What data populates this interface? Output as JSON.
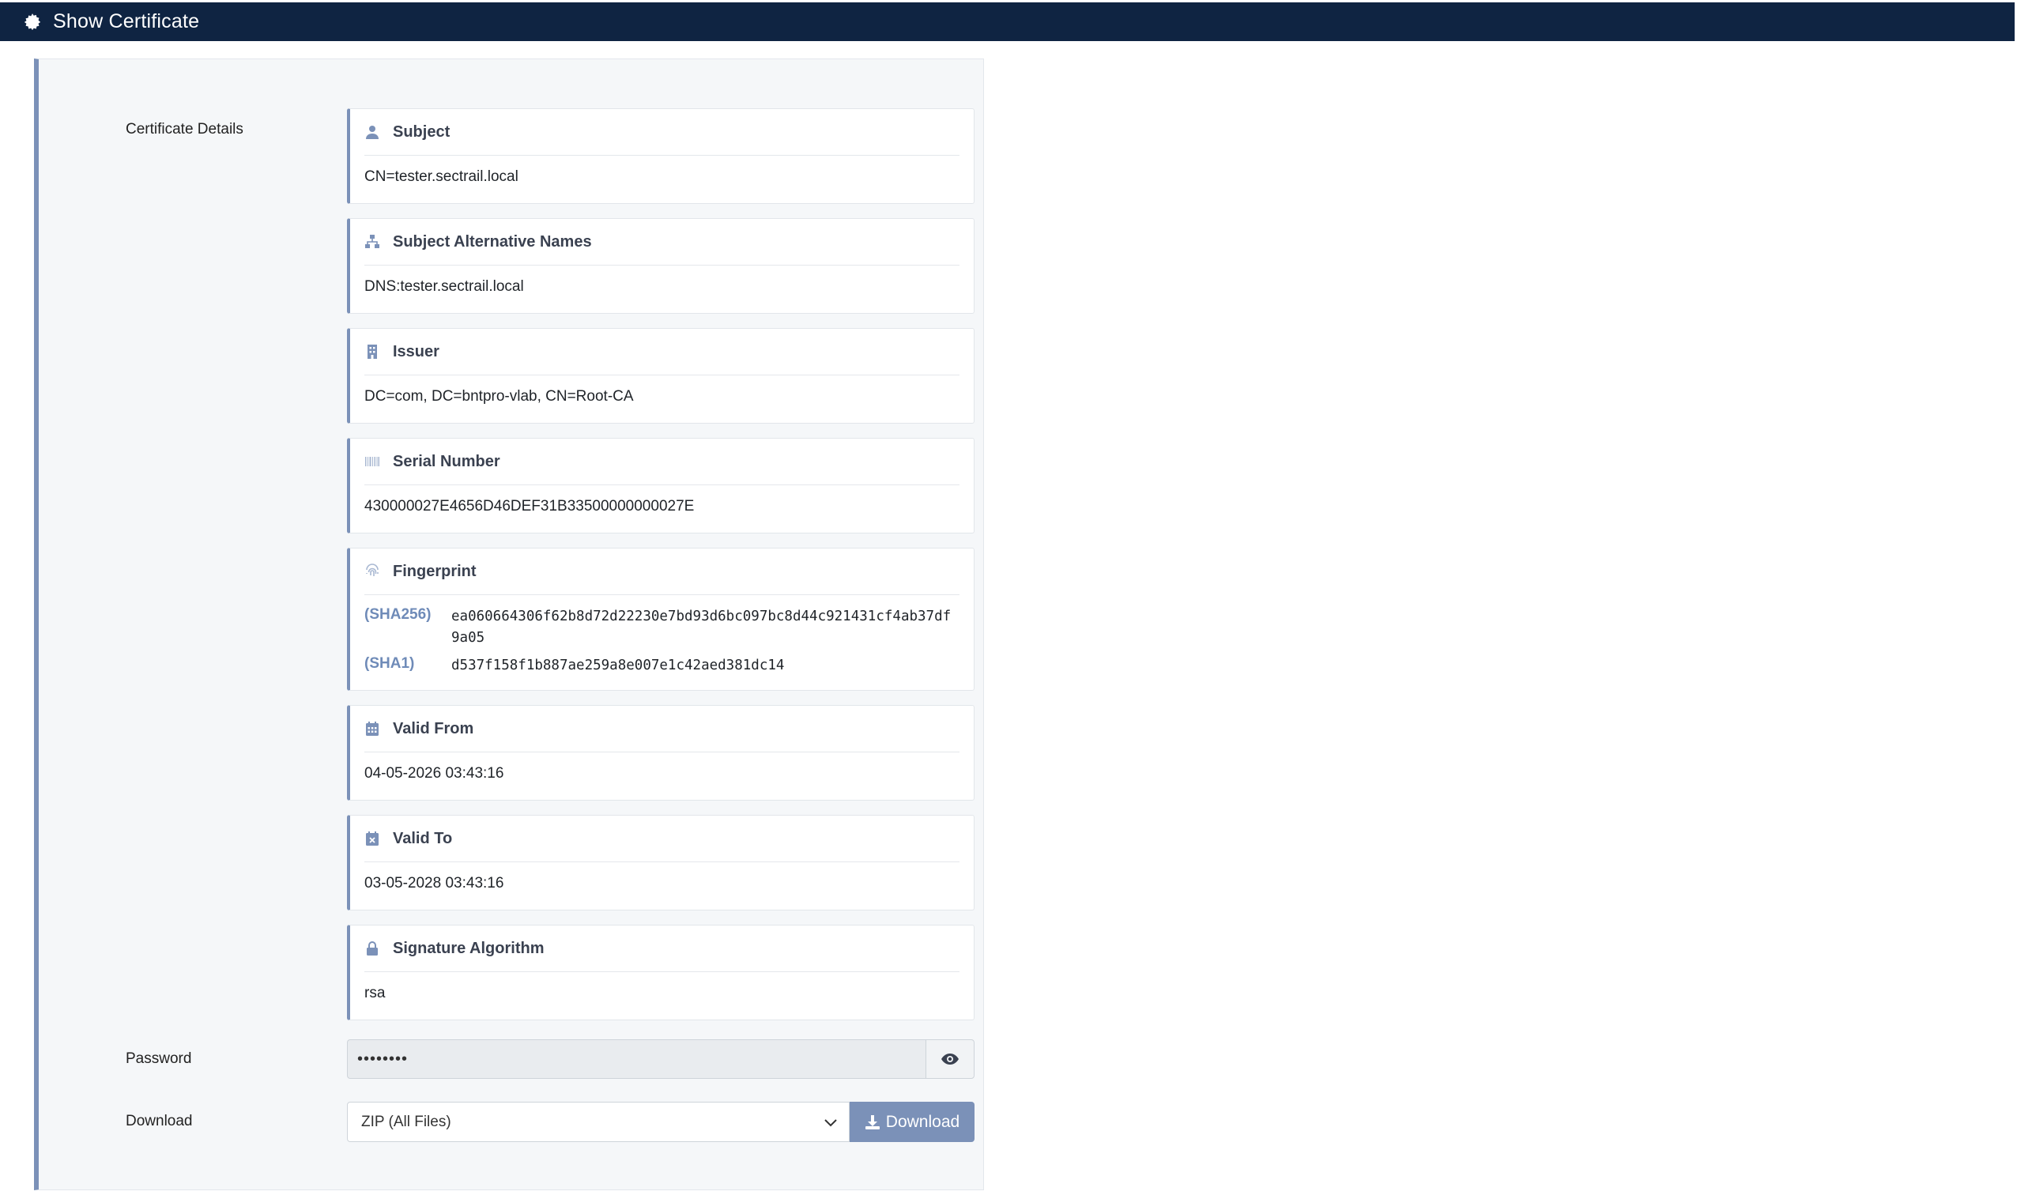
{
  "header": {
    "title": "Show Certificate",
    "icon": "gear-icon"
  },
  "form": {
    "details_label": "Certificate Details",
    "password_label": "Password",
    "download_label": "Download"
  },
  "cards": {
    "subject": {
      "title": "Subject",
      "value": "CN=tester.sectrail.local",
      "icon": "user-icon"
    },
    "san": {
      "title": "Subject Alternative Names",
      "value": "DNS:tester.sectrail.local",
      "icon": "sitemap-icon"
    },
    "issuer": {
      "title": "Issuer",
      "value": "DC=com, DC=bntpro-vlab, CN=Root-CA",
      "icon": "building-icon"
    },
    "serial": {
      "title": "Serial Number",
      "value": "430000027E4656D46DEF31B33500000000027E",
      "icon": "barcode-icon"
    },
    "fingerprint": {
      "title": "Fingerprint",
      "icon": "fingerprint-icon",
      "sha256_label": "(SHA256)",
      "sha256_value": "ea060664306f62b8d72d22230e7bd93d6bc097bc8d44c921431cf4ab37df9a05",
      "sha1_label": "(SHA1)",
      "sha1_value": "d537f158f1b887ae259a8e007e1c42aed381dc14"
    },
    "valid_from": {
      "title": "Valid From",
      "value": "04-05-2026 03:43:16",
      "icon": "calendar-icon"
    },
    "valid_to": {
      "title": "Valid To",
      "value": "03-05-2028 03:43:16",
      "icon": "calendar-x-icon"
    },
    "sig_alg": {
      "title": "Signature Algorithm",
      "value": "rsa",
      "icon": "lock-icon"
    }
  },
  "password": {
    "value": "••••••••",
    "toggle_icon": "eye-icon"
  },
  "download": {
    "selected": "ZIP (All Files)",
    "button_label": "Download",
    "button_icon": "download-icon"
  },
  "colors": {
    "header_bg": "#0f2442",
    "accent": "#7b91b8",
    "panel_bg": "#f5f7f9"
  }
}
